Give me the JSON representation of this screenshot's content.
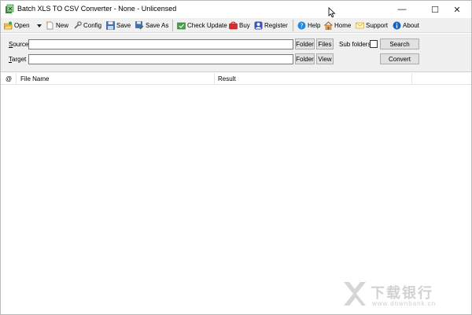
{
  "window": {
    "title": "Batch XLS TO CSV Converter - None - Unlicensed",
    "minimize_glyph": "—",
    "maximize_glyph": "☐",
    "close_glyph": "✕"
  },
  "toolbar": {
    "open": "Open",
    "new": "New",
    "config": "Config",
    "save": "Save",
    "save_as": "Save As",
    "check_update": "Check Update",
    "buy": "Buy",
    "register": "Register",
    "help": "Help",
    "home": "Home",
    "support": "Support",
    "about": "About"
  },
  "form": {
    "source_label_u": "S",
    "source_label_rest": "ource",
    "target_label_u": "T",
    "target_label_rest": "arget",
    "source_value": "",
    "target_value": "",
    "source_folder_btn": "Folder",
    "source_files_btn": "Files",
    "target_folder_btn": "Folder",
    "target_view_btn": "View",
    "subfolders_label": "Sub folders",
    "subfolders_checked": false,
    "search_btn": "Search",
    "convert_btn": "Convert"
  },
  "list": {
    "columns": [
      "@",
      "File Name",
      "Result"
    ],
    "rows": []
  },
  "watermark": {
    "text": "下载银行",
    "sub": "www.downbank.cn"
  },
  "colors": {
    "toolbar_bg": "#f0f0f0",
    "button_bg": "#e1e1e1",
    "watermark": "#d2d2d2"
  }
}
